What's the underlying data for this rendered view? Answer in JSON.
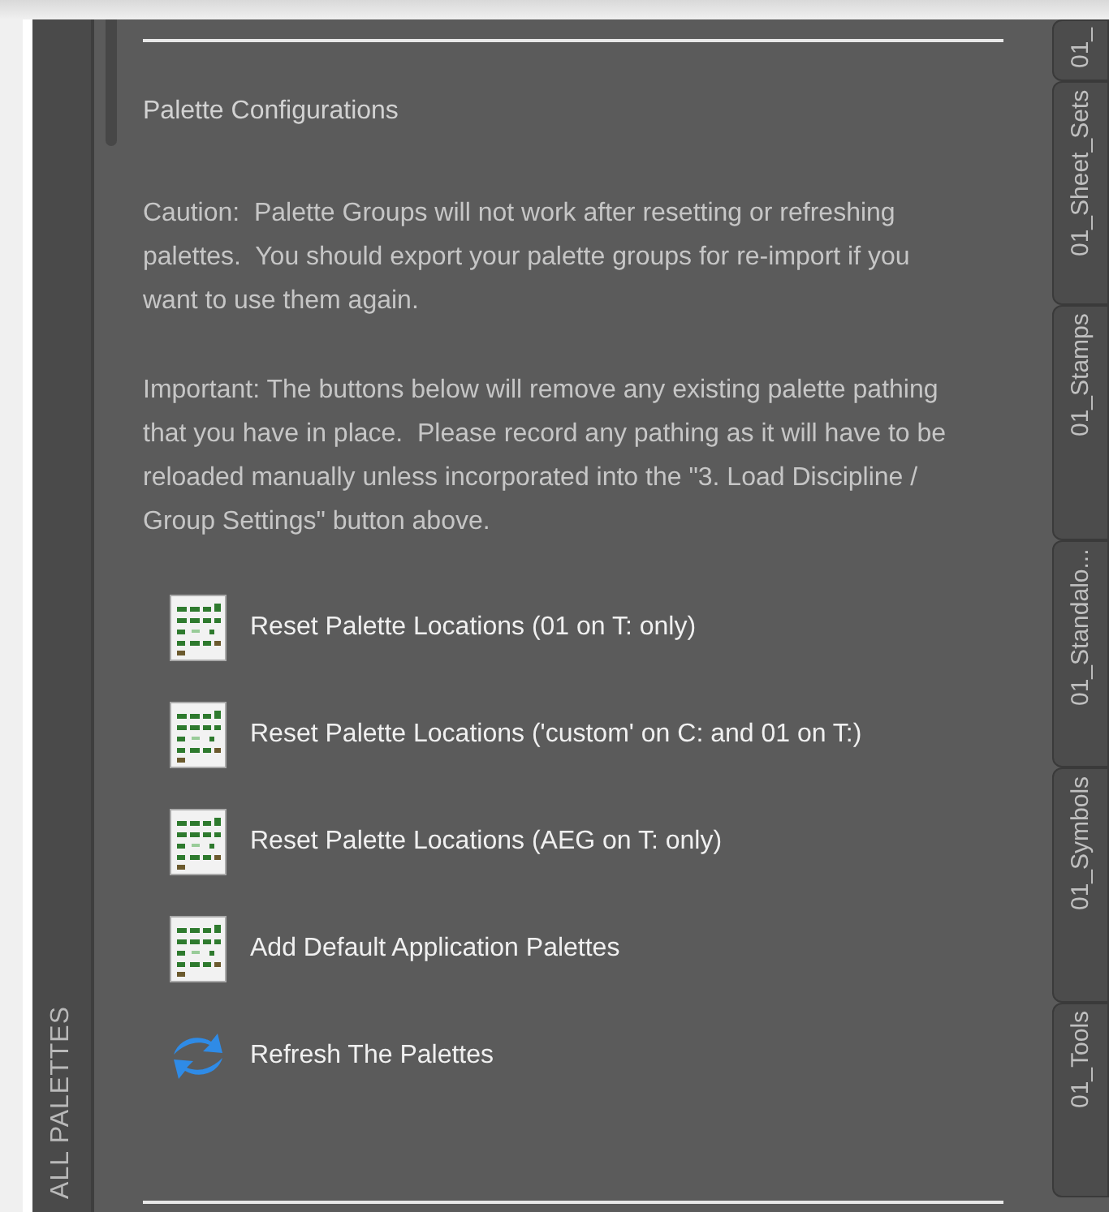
{
  "side_label": "ALL PALETTES",
  "title": "Palette Configurations",
  "paragraphs": [
    "Caution:  Palette Groups will not work after resetting or refreshing palettes.  You should export your palette groups for re-import if you want to use them again.",
    "Important: The buttons below will remove any existing palette pathing that you have in place.  Please record any pathing as it will have to be reloaded manually unless incorporated into the \"3. Load Discipline / Group Settings\" button above."
  ],
  "buttons": [
    {
      "kind": "palette",
      "label": "Reset Palette Locations (01 on T: only)"
    },
    {
      "kind": "palette",
      "label": "Reset Palette Locations ('custom' on C: and 01 on T:)"
    },
    {
      "kind": "palette",
      "label": "Reset Palette Locations (AEG on T: only)"
    },
    {
      "kind": "palette",
      "label": "Add Default Application Palettes"
    },
    {
      "kind": "refresh",
      "label": "Refresh The Palettes"
    }
  ],
  "tabs": [
    "01_",
    "01_Sheet_Sets",
    "01_Stamps",
    "01_Standalo...",
    "01_Symbols",
    "01_Tools"
  ]
}
